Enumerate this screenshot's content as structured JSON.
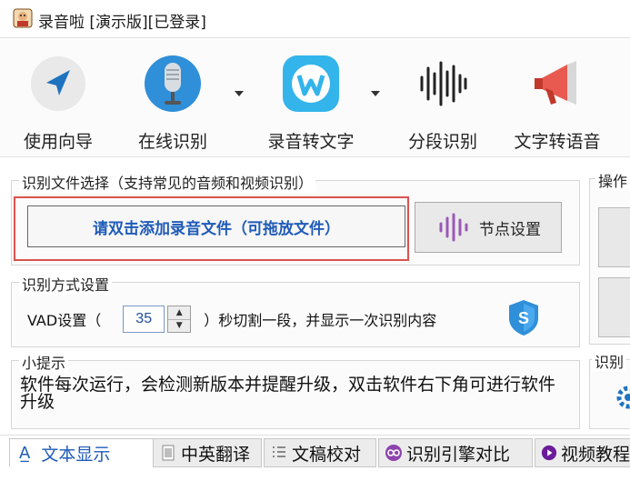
{
  "window": {
    "title": "录音啦 [演示版][已登录]"
  },
  "toolbar": {
    "guide_label": "使用向导",
    "online_label": "在线识别",
    "convert_label": "录音转文字",
    "segment_label": "分段识别",
    "tts_label": "文字转语音"
  },
  "file_select": {
    "legend": "识别文件选择（支持常见的音频和视频识别）",
    "add_file_label": "请双击添加录音文件（可拖放文件）",
    "node_settings_label": "节点设置"
  },
  "recognition_mode": {
    "legend": "识别方式设置",
    "vad_prefix": "VAD设置（",
    "vad_value": "35",
    "vad_suffix": "）秒切割一段，并显示一次识别内容"
  },
  "tips": {
    "legend": "小提示",
    "text": "软件每次运行，会检测新版本并提醒升级，双击软件右下角可进行软件升级"
  },
  "right_panel": {
    "op_legend": "操作",
    "engine_legend": "识别"
  },
  "tabs": [
    {
      "label": "文本显示",
      "icon": "text-a-icon",
      "active": true
    },
    {
      "label": "中英翻译",
      "icon": "document-icon",
      "active": false
    },
    {
      "label": "文稿校对",
      "icon": "list-icon",
      "active": false
    },
    {
      "label": "识别引擎对比",
      "icon": "infinity-icon",
      "active": false
    },
    {
      "label": "视频教程",
      "icon": "play-icon",
      "active": false
    }
  ],
  "colors": {
    "accent_blue": "#1f5bb8",
    "highlight_red": "#d9534f",
    "wave_purple": "#9b59b6"
  }
}
